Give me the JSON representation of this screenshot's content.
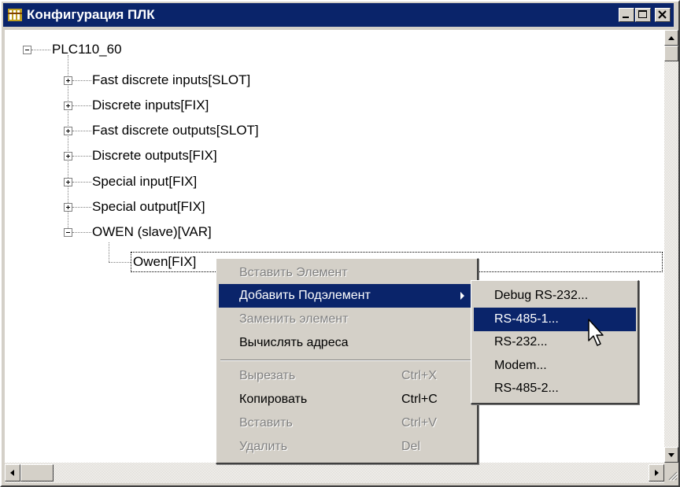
{
  "window": {
    "title": "Конфигурация ПЛК",
    "icon": "plc-config-icon"
  },
  "title_buttons": {
    "minimize": "minimize-icon",
    "maximize": "maximize-icon",
    "close": "close-icon"
  },
  "tree": {
    "root": {
      "label": "PLC110_60",
      "expanded": true
    },
    "children": [
      {
        "label": "Fast discrete inputs[SLOT]",
        "expanded": false
      },
      {
        "label": "Discrete inputs[FIX]",
        "expanded": false
      },
      {
        "label": "Fast discrete outputs[SLOT]",
        "expanded": false
      },
      {
        "label": "Discrete outputs[FIX]",
        "expanded": false
      },
      {
        "label": "Special input[FIX]",
        "expanded": false
      },
      {
        "label": "Special output[FIX]",
        "expanded": false
      },
      {
        "label": "OWEN (slave)[VAR]",
        "expanded": true
      }
    ],
    "selected_child": {
      "label": "Owen[FIX]"
    }
  },
  "context_menu": {
    "items": [
      {
        "label": "Вставить Элемент",
        "enabled": false
      },
      {
        "label": "Добавить Подэлемент",
        "enabled": true,
        "highlighted": true,
        "submenu": true
      },
      {
        "label": "Заменить элемент",
        "enabled": false
      },
      {
        "label": "Вычислять адреса",
        "enabled": true
      }
    ],
    "edit_items": [
      {
        "label": "Вырезать",
        "shortcut": "Ctrl+X",
        "enabled": false
      },
      {
        "label": "Копировать",
        "shortcut": "Ctrl+C",
        "enabled": true
      },
      {
        "label": "Вставить",
        "shortcut": "Ctrl+V",
        "enabled": false
      },
      {
        "label": "Удалить",
        "shortcut": "Del",
        "enabled": false
      }
    ]
  },
  "submenu": {
    "items": [
      {
        "label": "Debug RS-232..."
      },
      {
        "label": "RS-485-1...",
        "highlighted": true
      },
      {
        "label": "RS-232..."
      },
      {
        "label": "Modem..."
      },
      {
        "label": "RS-485-2..."
      }
    ]
  },
  "colors": {
    "highlight": "#0a246a",
    "face": "#d4d0c8",
    "disabled_text": "#808080"
  }
}
